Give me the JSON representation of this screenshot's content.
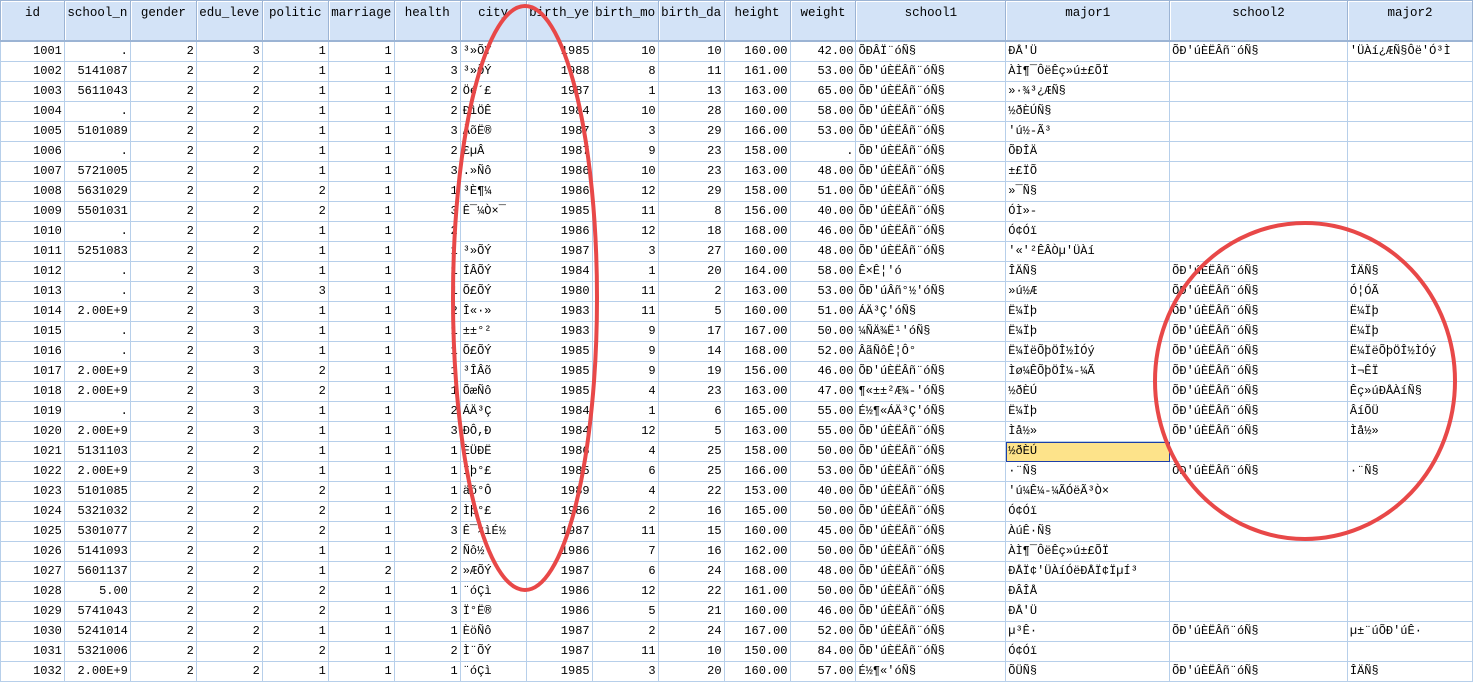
{
  "columns": [
    {
      "name": "id",
      "type": "num"
    },
    {
      "name": "school_n",
      "type": "num"
    },
    {
      "name": "gender",
      "type": "num"
    },
    {
      "name": "edu_leve",
      "type": "num"
    },
    {
      "name": "politic",
      "type": "num"
    },
    {
      "name": "marriage",
      "type": "num"
    },
    {
      "name": "health",
      "type": "num"
    },
    {
      "name": "city",
      "type": "str"
    },
    {
      "name": "birth_ye",
      "type": "num"
    },
    {
      "name": "birth_mo",
      "type": "num"
    },
    {
      "name": "birth_da",
      "type": "num"
    },
    {
      "name": "height",
      "type": "num"
    },
    {
      "name": "weight",
      "type": "num"
    },
    {
      "name": "school1",
      "type": "str"
    },
    {
      "name": "major1",
      "type": "str"
    },
    {
      "name": "school2",
      "type": "str"
    },
    {
      "name": "major2",
      "type": "str"
    }
  ],
  "selected_cell": {
    "row_id": "1021",
    "column": "major1"
  },
  "annotation_color": "#e84848",
  "rows": [
    [
      "1001",
      ".",
      "2",
      "3",
      "1",
      "1",
      "3",
      "³»ÕÝ",
      "1985",
      "10",
      "10",
      "160.00",
      "42.00",
      "ÕÐÂÏ¨óÑ§",
      "ÐÅ'Ü",
      "ÕÐ'úÈËÂñ¨óÑ§",
      "'ÜÀí¿ÆÑ§Ôë'Ó³Ì"
    ],
    [
      "1002",
      "5141087",
      "2",
      "2",
      "1",
      "1",
      "3",
      "³»ÕÝ",
      "1988",
      "8",
      "11",
      "161.00",
      "53.00",
      "ÕÐ'úÈËÂñ¨óÑ§",
      "ÀÌ¶¯ÔëÊç»ú±£ÕÏ",
      "",
      ""
    ],
    [
      "1003",
      "5611043",
      "2",
      "2",
      "1",
      "1",
      "2",
      "Öé´£",
      "1987",
      "1",
      "13",
      "163.00",
      "65.00",
      "ÕÐ'úÈËÂñ¨óÑ§",
      "»·¾³¿ÆÑ§",
      "",
      ""
    ],
    [
      "1004",
      ".",
      "2",
      "2",
      "1",
      "1",
      "2",
      "ÐìÖÊ",
      "1984",
      "10",
      "28",
      "160.00",
      "58.00",
      "ÕÐ'úÈËÂñ¨óÑ§",
      "½ðÈÚÑ§",
      "",
      ""
    ],
    [
      "1005",
      "5101089",
      "2",
      "2",
      "1",
      "1",
      "3",
      "ÀõË®",
      "1987",
      "3",
      "29",
      "166.00",
      "53.00",
      "ÕÐ'úÈËÂñ¨óÑ§",
      "'ú½-Ã³",
      "",
      ""
    ],
    [
      "1006",
      ".",
      "2",
      "2",
      "1",
      "1",
      "2",
      "£µÂ",
      "1987",
      "9",
      "23",
      "158.00",
      ".",
      "ÕÐ'úÈËÂñ¨óÑ§",
      "ÕÐÎÄ",
      "",
      ""
    ],
    [
      "1007",
      "5721005",
      "2",
      "2",
      "1",
      "1",
      "3",
      ".»Ñô",
      "1986",
      "10",
      "23",
      "163.00",
      "48.00",
      "ÕÐ'úÈËÂñ¨óÑ§",
      "±£ÏÕ",
      "",
      ""
    ],
    [
      "1008",
      "5631029",
      "2",
      "2",
      "2",
      "1",
      "1",
      "³È¶¼",
      "1986",
      "12",
      "29",
      "158.00",
      "51.00",
      "ÕÐ'úÈËÂñ¨óÑ§",
      "»¯Ñ§",
      "",
      ""
    ],
    [
      "1009",
      "5501031",
      "2",
      "2",
      "2",
      "1",
      "3",
      "Ê¯¼Ò×¯",
      "1985",
      "11",
      "8",
      "156.00",
      "40.00",
      "ÕÐ'úÈËÂñ¨óÑ§",
      "ÓÌ»-",
      "",
      ""
    ],
    [
      "1010",
      ".",
      "2",
      "2",
      "1",
      "1",
      "2",
      "",
      "1986",
      "12",
      "18",
      "168.00",
      "46.00",
      "ÕÐ'úÈËÂñ¨óÑ§",
      "Ó¢Óï",
      "",
      ""
    ],
    [
      "1011",
      "5251083",
      "2",
      "2",
      "1",
      "1",
      "1",
      "³»ÕÝ",
      "1987",
      "3",
      "27",
      "160.00",
      "48.00",
      "ÕÐ'úÈËÂñ¨óÑ§",
      "'«'²ÊÂÒµ'ÜÀí",
      "",
      ""
    ],
    [
      "1012",
      ".",
      "2",
      "3",
      "1",
      "1",
      "1",
      "ÎÂÕÝ",
      "1984",
      "1",
      "20",
      "164.00",
      "58.00",
      "Ê×Ê¦'ó",
      "ÎÄÑ§",
      "ÕÐ'úÈËÂñ¨óÑ§",
      "ÎÄÑ§"
    ],
    [
      "1013",
      ".",
      "2",
      "3",
      "3",
      "1",
      "1",
      "Õ£ÕÝ",
      "1980",
      "11",
      "2",
      "163.00",
      "53.00",
      "ÕÐ'úÂñ°½'óÑ§",
      "»ú½Æ",
      "ÕÐ'úÈËÂñ¨óÑ§",
      "Ó¦ÓÃ"
    ],
    [
      "1014",
      "2.00E+9",
      "2",
      "3",
      "1",
      "1",
      "2",
      "Î«·»",
      "1983",
      "11",
      "5",
      "160.00",
      "51.00",
      "ÁÄ³Ç'óÑ§",
      "Ë¼Ïþ",
      "ÕÐ'úÈËÂñ¨óÑ§",
      "Ë¼Ïþ"
    ],
    [
      "1015",
      ".",
      "2",
      "3",
      "1",
      "1",
      "1",
      "±±°²",
      "1983",
      "9",
      "17",
      "167.00",
      "50.00",
      "¼ÑÄ¾Ë¹'óÑ§",
      "Ë¼Ïþ",
      "ÕÐ'úÈËÂñ¨óÑ§",
      "Ë¼Ïþ"
    ],
    [
      "1016",
      ".",
      "2",
      "3",
      "1",
      "1",
      "1",
      "Õ£ÕÝ",
      "1985",
      "9",
      "14",
      "168.00",
      "52.00",
      "ÂãÑôÊ¦Ô°",
      "Ë¼ÏëÕþÖÎ½ÌÓý",
      "ÕÐ'úÈËÂñ¨óÑ§",
      "Ë¼ÏëÕþÖÎ½ÌÓý"
    ],
    [
      "1017",
      "2.00E+9",
      "2",
      "3",
      "2",
      "1",
      "1",
      "³ÎÂõ",
      "1985",
      "9",
      "19",
      "156.00",
      "46.00",
      "ÕÐ'úÈËÂñ¨óÑ§",
      "Ìø¼ÊÕþÖÎ¼-¼Ã",
      "ÕÐ'úÈËÂñ¨óÑ§",
      "Ì¬ÊÏ"
    ],
    [
      "1018",
      "2.00E+9",
      "2",
      "3",
      "2",
      "1",
      "1",
      "ÕæÑô",
      "1985",
      "4",
      "23",
      "163.00",
      "47.00",
      "¶«±±²Æ¾-'óÑ§",
      "½ðÈÚ",
      "ÕÐ'úÈËÂñ¨óÑ§",
      "Êç»úÐÅÀíÑ§"
    ],
    [
      "1019",
      ".",
      "2",
      "3",
      "1",
      "1",
      "2",
      "ÁÄ³Ç",
      "1984",
      "1",
      "6",
      "165.00",
      "55.00",
      "É½¶«ÁÄ³Ç'óÑ§",
      "Ë¼Ïþ",
      "ÕÐ'úÈËÂñ¨óÑ§",
      "ÂíÕÜ"
    ],
    [
      "1020",
      "2.00E+9",
      "2",
      "3",
      "1",
      "1",
      "3",
      "ÐÔ,Ð",
      "1984",
      "12",
      "5",
      "163.00",
      "55.00",
      "ÕÐ'úÈËÂñ¨óÑ§",
      "Ìå½»",
      "ÕÐ'úÈËÂñ¨óÑ§",
      "Ìå½»"
    ],
    [
      "1021",
      "5131103",
      "2",
      "2",
      "1",
      "1",
      "1",
      "ÈÜÐË",
      "1986",
      "4",
      "25",
      "158.00",
      "50.00",
      "ÕÐ'úÈËÂñ¨óÑ§",
      "½ðÈÚ",
      "",
      ""
    ],
    [
      "1022",
      "2.00E+9",
      "2",
      "3",
      "1",
      "1",
      "1",
      "Ìþ°£",
      "1985",
      "6",
      "25",
      "166.00",
      "53.00",
      "ÕÐ'úÈËÂñ¨óÑ§",
      "·¨Ñ§",
      "ÕÐ'úÈËÂñ¨óÑ§",
      "·¨Ñ§"
    ],
    [
      "1023",
      "5101085",
      "2",
      "2",
      "2",
      "1",
      "1",
      "äõ°Ô",
      "1989",
      "4",
      "22",
      "153.00",
      "40.00",
      "ÕÐ'úÈËÂñ¨óÑ§",
      "'ú¼Ê¼-¼ÃÓëÃ³Ò×",
      "",
      ""
    ],
    [
      "1024",
      "5321032",
      "2",
      "2",
      "2",
      "1",
      "2",
      "Ìþ°£",
      "1986",
      "2",
      "16",
      "165.00",
      "50.00",
      "ÕÐ'úÈËÂñ¨óÑ§",
      "Ó¢Óï",
      "",
      ""
    ],
    [
      "1025",
      "5301077",
      "2",
      "2",
      "2",
      "1",
      "3",
      "Ê¯×ìÉ½",
      "1987",
      "11",
      "15",
      "160.00",
      "45.00",
      "ÕÐ'úÈËÂñ¨óÑ§",
      "ÀúÊ·Ñ§",
      "",
      ""
    ],
    [
      "1026",
      "5141093",
      "2",
      "2",
      "1",
      "1",
      "2",
      "Ñô½",
      "1986",
      "7",
      "16",
      "162.00",
      "50.00",
      "ÕÐ'úÈËÂñ¨óÑ§",
      "ÀÌ¶¯ÔëÊç»ú±£ÕÏ",
      "",
      ""
    ],
    [
      "1027",
      "5601137",
      "2",
      "2",
      "1",
      "2",
      "2",
      "»ÆÕÝ",
      "1987",
      "6",
      "24",
      "168.00",
      "48.00",
      "ÕÐ'úÈËÂñ¨óÑ§",
      "ÐÅÏ¢'ÜÀíÓëÐÅÏ¢ÏµÍ³",
      "",
      ""
    ],
    [
      "1028",
      "5.00",
      "2",
      "2",
      "2",
      "1",
      "1",
      "¨óÇì",
      "1986",
      "12",
      "22",
      "161.00",
      "50.00",
      "ÕÐ'úÈËÂñ¨óÑ§",
      "ÐÂÎÅ",
      "",
      ""
    ],
    [
      "1029",
      "5741043",
      "2",
      "2",
      "2",
      "1",
      "3",
      "Ï°Ë®",
      "1986",
      "5",
      "21",
      "160.00",
      "46.00",
      "ÕÐ'úÈËÂñ¨óÑ§",
      "ÐÅ'Ü",
      "",
      ""
    ],
    [
      "1030",
      "5241014",
      "2",
      "2",
      "1",
      "1",
      "1",
      "ÈöÑô",
      "1987",
      "2",
      "24",
      "167.00",
      "52.00",
      "ÕÐ'úÈËÂñ¨óÑ§",
      "µ³Ê·",
      "ÕÐ'úÈËÂñ¨óÑ§",
      "µ±¨úÕÐ'úÊ·"
    ],
    [
      "1031",
      "5321006",
      "2",
      "2",
      "2",
      "1",
      "2",
      "Ì¨ÕÝ",
      "1987",
      "11",
      "10",
      "150.00",
      "84.00",
      "ÕÐ'úÈËÂñ¨óÑ§",
      "Ó¢Óï",
      "",
      ""
    ],
    [
      "1032",
      "2.00E+9",
      "2",
      "2",
      "1",
      "1",
      "1",
      "¨óÇì",
      "1985",
      "3",
      "20",
      "160.00",
      "57.00",
      "É½¶«'óÑ§",
      "ÕÜÑ§",
      "ÕÐ'úÈËÂñ¨óÑ§",
      "ÎÄÑ§"
    ]
  ]
}
